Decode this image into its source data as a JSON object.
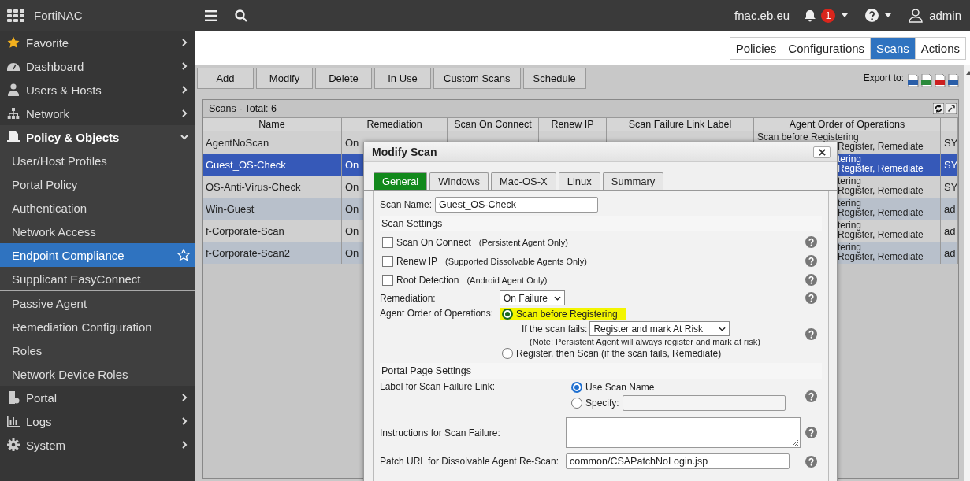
{
  "app": {
    "name": "FortiNAC"
  },
  "topbar": {
    "host": "fnac.eb.eu",
    "alert_count": "1",
    "user": "admin"
  },
  "sidebar": {
    "items": [
      {
        "label": "Favorite",
        "expanded": false
      },
      {
        "label": "Dashboard",
        "expanded": false
      },
      {
        "label": "Users & Hosts",
        "expanded": false
      },
      {
        "label": "Network",
        "expanded": false
      },
      {
        "label": "Policy & Objects",
        "expanded": true,
        "children": [
          {
            "label": "User/Host Profiles",
            "selected": false,
            "divider_after": false
          },
          {
            "label": "Portal Policy",
            "selected": false,
            "divider_after": false
          },
          {
            "label": "Authentication",
            "selected": false,
            "divider_after": false
          },
          {
            "label": "Network Access",
            "selected": false,
            "divider_after": false
          },
          {
            "label": "Endpoint Compliance",
            "selected": true,
            "divider_after": false
          },
          {
            "label": "Supplicant EasyConnect",
            "selected": false,
            "divider_after": true
          },
          {
            "label": "Passive Agent",
            "selected": false,
            "divider_after": false
          },
          {
            "label": "Remediation Configuration",
            "selected": false,
            "divider_after": false
          },
          {
            "label": "Roles",
            "selected": false,
            "divider_after": false
          },
          {
            "label": "Network Device Roles",
            "selected": false,
            "divider_after": false
          }
        ]
      },
      {
        "label": "Portal",
        "expanded": false
      },
      {
        "label": "Logs",
        "expanded": false
      },
      {
        "label": "System",
        "expanded": false
      }
    ]
  },
  "page_tabs": [
    {
      "label": "Policies",
      "selected": false
    },
    {
      "label": "Configurations",
      "selected": false
    },
    {
      "label": "Scans",
      "selected": true
    },
    {
      "label": "Actions",
      "selected": false
    }
  ],
  "toolbar": [
    "Add",
    "Modify",
    "Delete",
    "In Use",
    "Custom Scans",
    "Schedule"
  ],
  "export": {
    "label": "Export to:"
  },
  "table": {
    "title": "Scans - Total: 6",
    "columns": [
      "Name",
      "Remediation",
      "Scan On Connect",
      "Renew IP",
      "Scan Failure Link Label",
      "Agent Order of Operations"
    ],
    "rows": [
      {
        "name": "AgentNoScan",
        "remediation": "On",
        "agent_order": [
          {
            "text": "Scan before Registering",
            "partly_hidden": false
          },
          {
            "text": "Register, Remediate",
            "partly_hidden": true
          }
        ],
        "column_7": "SY",
        "selected": false
      },
      {
        "name": "Guest_OS-Check",
        "remediation": "On",
        "agent_order": [
          {
            "text": "tering",
            "partly_hidden": true
          },
          {
            "text": "Register, Remediate",
            "partly_hidden": true
          }
        ],
        "column_7": "SY",
        "selected": true
      },
      {
        "name": "OS-Anti-Virus-Check",
        "remediation": "On",
        "agent_order": [
          {
            "text": "tering",
            "partly_hidden": true
          },
          {
            "text": "Register, Remediate",
            "partly_hidden": true
          }
        ],
        "column_7": "SY",
        "selected": false
      },
      {
        "name": "Win-Guest",
        "remediation": "On",
        "agent_order": [
          {
            "text": "tering",
            "partly_hidden": true
          },
          {
            "text": "Register, Remediate",
            "partly_hidden": true
          }
        ],
        "column_7": "ad",
        "selected": false
      },
      {
        "name": "f-Corporate-Scan",
        "remediation": "On",
        "agent_order": [
          {
            "text": "tering",
            "partly_hidden": true
          },
          {
            "text": "Register, Remediate",
            "partly_hidden": true
          }
        ],
        "column_7": "ad",
        "selected": false
      },
      {
        "name": "f-Corporate-Scan2",
        "remediation": "On",
        "agent_order": [
          {
            "text": "tering",
            "partly_hidden": true
          },
          {
            "text": "Register, Remediate",
            "partly_hidden": true
          }
        ],
        "column_7": "ad",
        "selected": false
      }
    ]
  },
  "dialog": {
    "title": "Modify Scan",
    "tabs": [
      {
        "label": "General",
        "selected": true
      },
      {
        "label": "Windows",
        "selected": false
      },
      {
        "label": "Mac-OS-X",
        "selected": false
      },
      {
        "label": "Linux",
        "selected": false
      },
      {
        "label": "Summary",
        "selected": false
      }
    ],
    "scan_name": {
      "label": "Scan Name:",
      "value": "Guest_OS-Check"
    },
    "scan_settings": {
      "heading": "Scan Settings",
      "options": [
        {
          "label": "Scan On Connect",
          "note": "(Persistent Agent Only)",
          "checked": false
        },
        {
          "label": "Renew IP",
          "note": "(Supported Dissolvable Agents Only)",
          "checked": false
        },
        {
          "label": "Root Detection",
          "note": "(Android Agent Only)",
          "checked": false
        }
      ]
    },
    "remediation": {
      "label": "Remediation:",
      "value": "On Failure"
    },
    "agent_order": {
      "label": "Agent Order of Operations:",
      "options": [
        {
          "label": "Scan before Registering",
          "selected": true,
          "highlighted": true
        },
        {
          "label": "Register, then Scan (if the scan fails, Remediate)",
          "selected": false,
          "highlighted": false
        }
      ],
      "fail_label": "If the scan fails:",
      "fail_value": "Register and mark At Risk",
      "note": "(Note: Persistent Agent will always register and mark at risk)"
    },
    "portal_settings": {
      "heading": "Portal Page Settings",
      "failure_link": {
        "label": "Label for Scan Failure Link:",
        "options": [
          {
            "label": "Use Scan Name",
            "selected": true
          },
          {
            "label": "Specify:",
            "selected": false
          }
        ]
      },
      "instructions": {
        "label": "Instructions for Scan Failure:"
      },
      "patch_url": {
        "label": "Patch URL for Dissolvable Agent Re-Scan:",
        "value": "common/CSAPatchNoLogin.jsp"
      }
    }
  }
}
